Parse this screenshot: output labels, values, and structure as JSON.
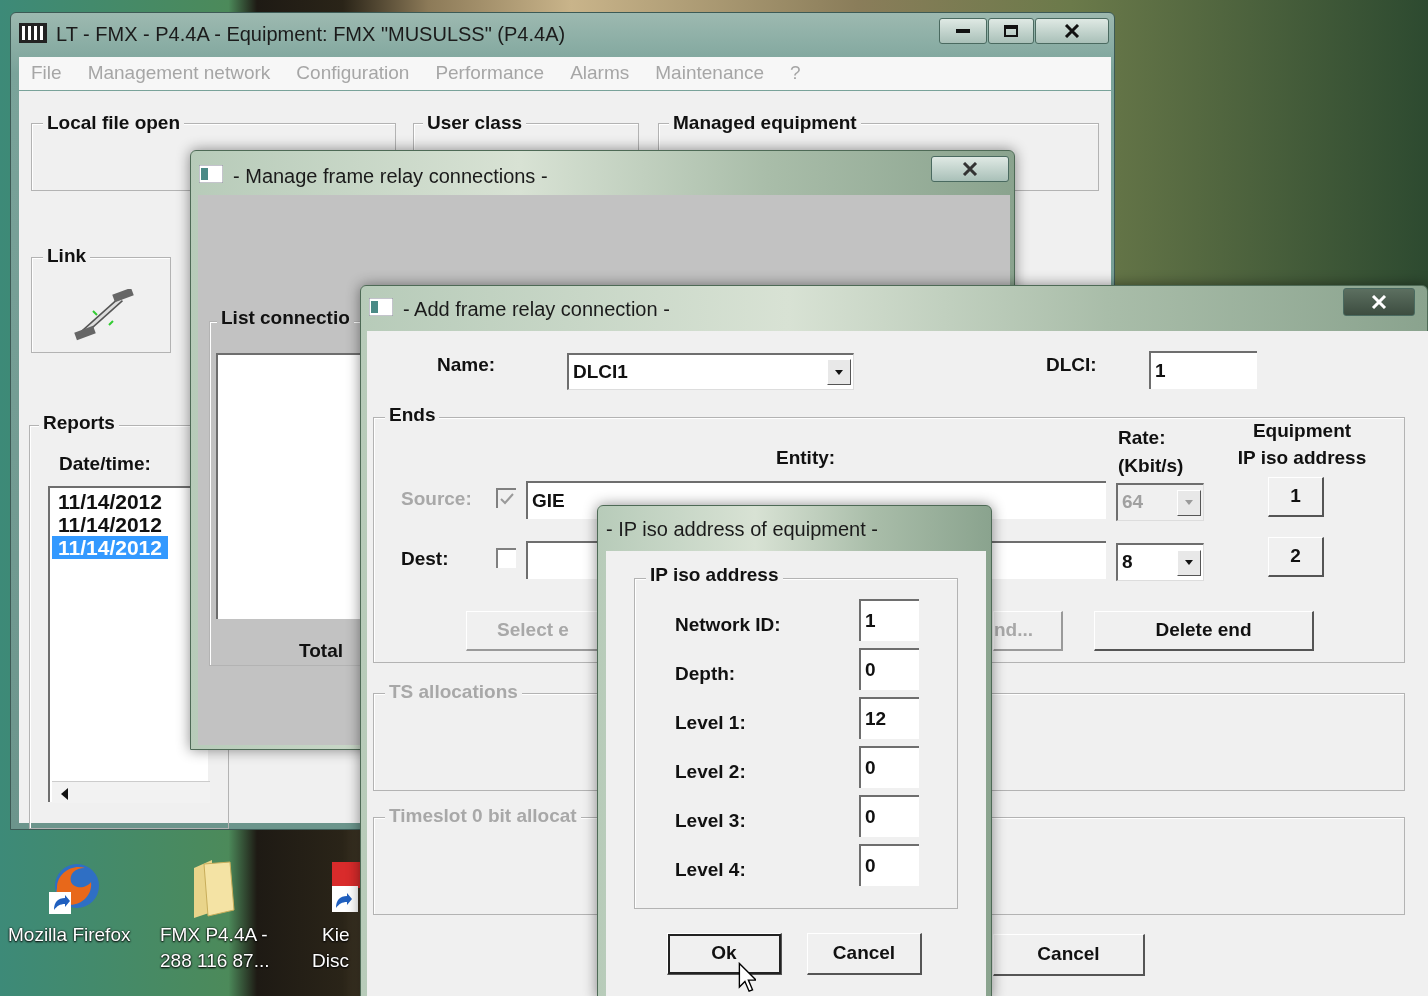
{
  "desktop": {
    "icons": [
      {
        "kind": "browser",
        "label_lines": [
          "Mozilla Firefox"
        ]
      },
      {
        "kind": "folder",
        "label_lines": [
          "FMX P4.4A -",
          "288 116 87..."
        ]
      },
      {
        "kind": "app",
        "label_lines": [
          "Kie",
          "Disc"
        ]
      }
    ]
  },
  "main_window": {
    "title": "LT - FMX - P4.4A - Equipment: FMX \"MUSULSS\" (P4.4A)",
    "menu": [
      {
        "label": "File",
        "disabled": true
      },
      {
        "label": "Management network",
        "disabled": true
      },
      {
        "label": "Configuration",
        "disabled": true
      },
      {
        "label": "Performance",
        "disabled": true
      },
      {
        "label": "Alarms",
        "disabled": true
      },
      {
        "label": "Maintenance",
        "disabled": true
      },
      {
        "label": "?",
        "disabled": true
      }
    ],
    "local_file_open_label": "Local file open",
    "user_class_label": "User class",
    "managed_equipment_label": "Managed equipment",
    "link_label": "Link",
    "reports": {
      "label": "Reports",
      "column_label": "Date/time:",
      "rows": [
        {
          "text": "11/14/2012",
          "selected": false
        },
        {
          "text": "11/14/2012",
          "selected": false
        },
        {
          "text": "11/14/2012",
          "selected": true
        }
      ]
    }
  },
  "manage_window": {
    "title": "- Manage frame relay connections -",
    "list_label": "List connectio",
    "total_label": "Total"
  },
  "add_window": {
    "title": "- Add frame relay connection -",
    "name_label": "Name:",
    "name_value": "DLCI1",
    "dlci_label": "DLCI:",
    "dlci_value": "1",
    "ends": {
      "label": "Ends",
      "entity_header": "Entity:",
      "rate_header_lines": [
        "Rate:",
        "(Kbit/s)"
      ],
      "equipment_header_lines": [
        "Equipment",
        "IP iso address"
      ],
      "rows": [
        {
          "label": "Source:",
          "disabled": true,
          "checked": true,
          "entity": "GIE",
          "rate": "64",
          "address_button": "1"
        },
        {
          "label": "Dest:",
          "disabled": false,
          "checked": false,
          "rate": "8",
          "address_button": "2"
        }
      ],
      "buttons": [
        {
          "label": "Select e",
          "disabled": true
        },
        {
          "label": "nd...",
          "disabled": true
        },
        {
          "label": "Delete end",
          "disabled": false
        }
      ]
    },
    "ts_allocations": {
      "label": "TS allocations",
      "disabled": true
    },
    "timeslot_allocations": {
      "label": "Timeslot 0 bit allocat",
      "disabled": true
    },
    "cancel_label": "Cancel"
  },
  "ip_dialog": {
    "title": "- IP iso address of equipment -",
    "group_label": "IP iso address",
    "fields": [
      {
        "label": "Network ID:",
        "value": "1"
      },
      {
        "label": "Depth:",
        "value": "0"
      },
      {
        "label": "Level 1:",
        "value": "12"
      },
      {
        "label": "Level 2:",
        "value": "0"
      },
      {
        "label": "Level 3:",
        "value": "0"
      },
      {
        "label": "Level 4:",
        "value": "0"
      }
    ],
    "ok_label": "Ok",
    "cancel_label": "Cancel"
  }
}
